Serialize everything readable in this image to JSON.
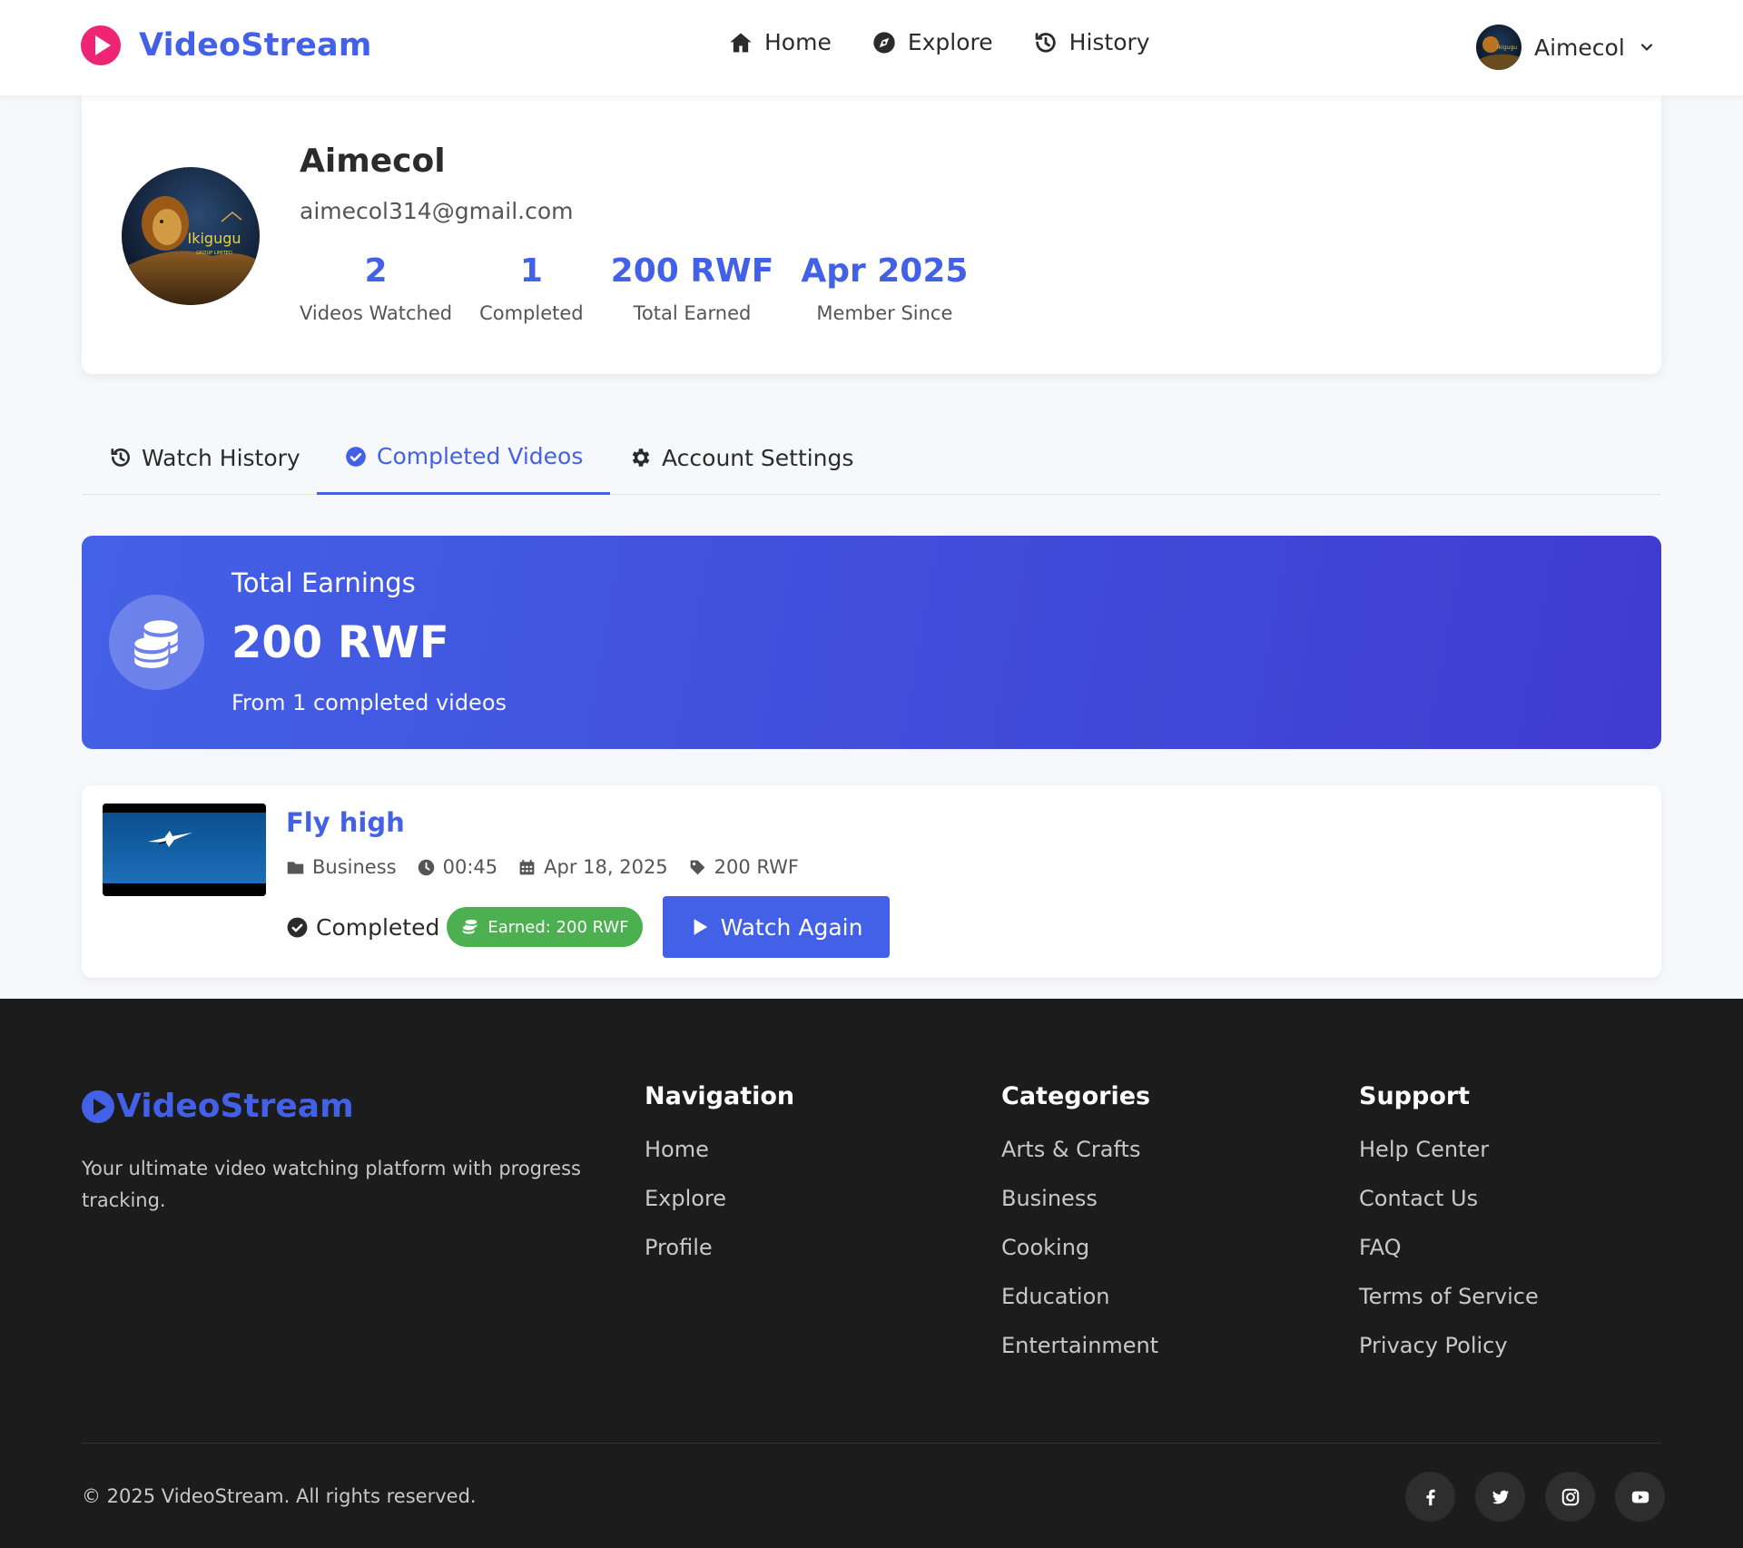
{
  "brand": {
    "name": "VideoStream",
    "logo_icon": "play-circle-icon",
    "accent": "#4361e6",
    "logo_color": "#ee2474"
  },
  "nav": {
    "items": [
      {
        "label": "Home",
        "icon": "home-icon"
      },
      {
        "label": "Explore",
        "icon": "compass-icon"
      },
      {
        "label": "History",
        "icon": "history-icon"
      }
    ]
  },
  "user": {
    "name": "Aimecol",
    "avatar_text": "Ikigugu",
    "avatar_subtext": "GROUP LIMITED"
  },
  "profile": {
    "name": "Aimecol",
    "email": "aimecol314@gmail.com",
    "stats": [
      {
        "value": "2",
        "label": "Videos Watched"
      },
      {
        "value": "1",
        "label": "Completed"
      },
      {
        "value": "200 RWF",
        "label": "Total Earned"
      },
      {
        "value": "Apr 2025",
        "label": "Member Since"
      }
    ]
  },
  "tabs": [
    {
      "label": "Watch History",
      "icon": "history-icon",
      "active": false
    },
    {
      "label": "Completed Videos",
      "icon": "check-circle-icon",
      "active": true
    },
    {
      "label": "Account Settings",
      "icon": "gear-icon",
      "active": false
    }
  ],
  "earnings": {
    "title": "Total Earnings",
    "amount": "200 RWF",
    "subtitle": "From 1 completed videos",
    "icon": "coins-icon",
    "gradient_start": "#4361e6",
    "gradient_end": "#3f3ccf"
  },
  "completed_videos": [
    {
      "title": "Fly high",
      "category": "Business",
      "duration": "00:45",
      "date": "Apr 18, 2025",
      "reward": "200 RWF",
      "status": "Completed",
      "earned": "Earned: 200 RWF",
      "action": "Watch Again"
    }
  ],
  "footer": {
    "brand": "VideoStream",
    "description": "Your ultimate video watching platform with progress tracking.",
    "columns": [
      {
        "title": "Navigation",
        "links": [
          "Home",
          "Explore",
          "Profile"
        ]
      },
      {
        "title": "Categories",
        "links": [
          "Arts & Crafts",
          "Business",
          "Cooking",
          "Education",
          "Entertainment"
        ]
      },
      {
        "title": "Support",
        "links": [
          "Help Center",
          "Contact Us",
          "FAQ",
          "Terms of Service",
          "Privacy Policy"
        ]
      }
    ],
    "copyright": "© 2025 VideoStream. All rights reserved.",
    "socials": [
      "facebook-icon",
      "twitter-icon",
      "instagram-icon",
      "youtube-icon"
    ]
  }
}
